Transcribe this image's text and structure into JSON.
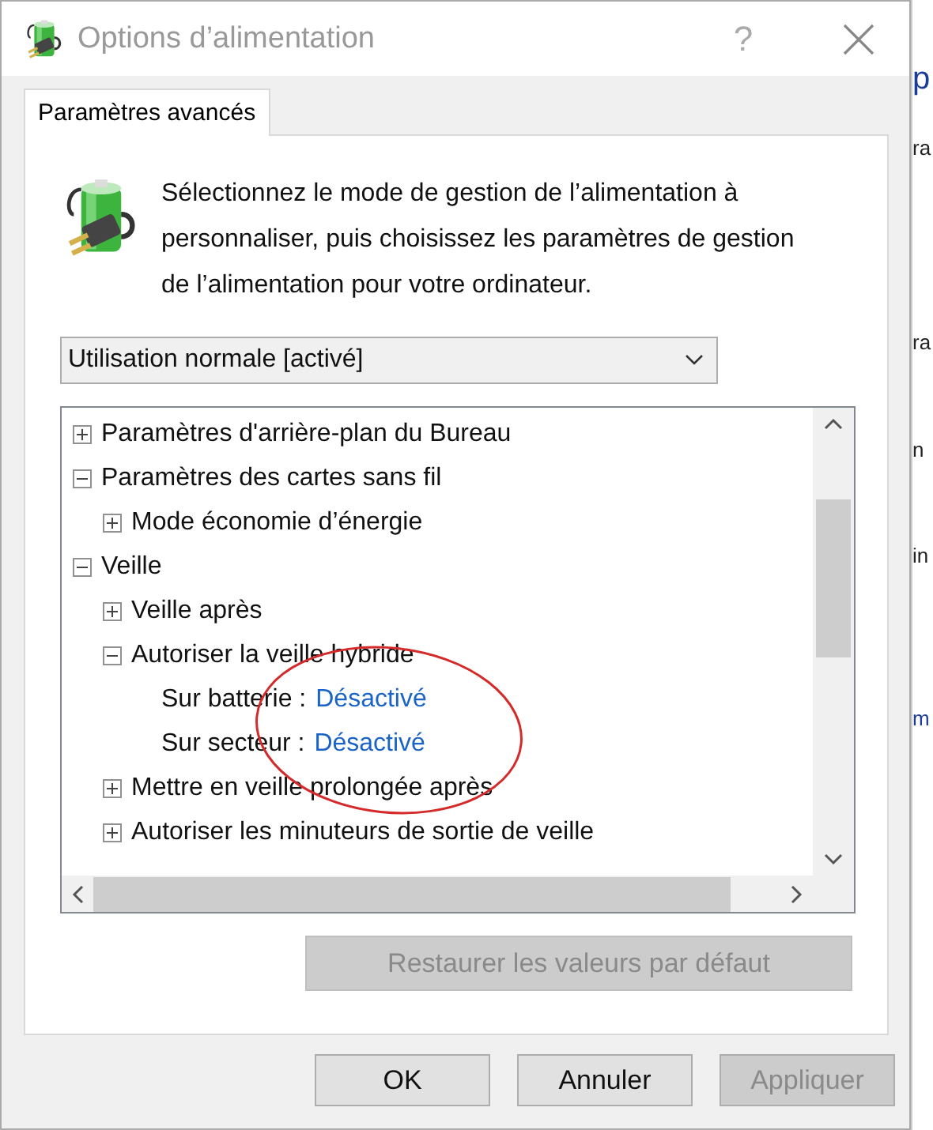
{
  "window": {
    "title": "Options d’alimentation",
    "help": "?"
  },
  "tabs": [
    {
      "label": "Paramètres avancés",
      "selected": true
    }
  ],
  "intro": "Sélectionnez le mode de gestion de l’alimentation à personnaliser, puis choisissez les paramètres de gestion de l’alimentation pour votre ordinateur.",
  "plan_dropdown": {
    "value": "Utilisation normale [activé]"
  },
  "tree": [
    {
      "kind": "group",
      "label": "Paramètres d'arrière-plan du Bureau",
      "expanded": false
    },
    {
      "kind": "group",
      "label": "Paramètres des cartes sans fil",
      "expanded": true,
      "children": [
        {
          "kind": "group",
          "label": "Mode économie d’énergie",
          "expanded": false
        }
      ]
    },
    {
      "kind": "group",
      "label": "Veille",
      "expanded": true,
      "children": [
        {
          "kind": "group",
          "label": "Veille après",
          "expanded": false
        },
        {
          "kind": "group",
          "label": "Autoriser la veille hybride",
          "expanded": true,
          "children": [
            {
              "kind": "setting",
              "label": "Sur batterie :",
              "value": "Désactivé"
            },
            {
              "kind": "setting",
              "label": "Sur secteur :",
              "value": "Désactivé"
            }
          ]
        },
        {
          "kind": "group",
          "label": "Mettre en veille prolongée après",
          "expanded": false
        },
        {
          "kind": "group",
          "label": "Autoriser les minuteurs de sortie de veille",
          "expanded": false
        }
      ]
    }
  ],
  "restore_button": {
    "label": "Restaurer les valeurs par défaut",
    "disabled": true
  },
  "buttons": [
    {
      "label": "OK",
      "disabled": false
    },
    {
      "label": "Annuler",
      "disabled": false
    },
    {
      "label": "Appliquer",
      "disabled": true
    }
  ],
  "background_window": [
    {
      "text": "p",
      "kind": "link"
    },
    {
      "text": "ra",
      "kind": "text"
    },
    {
      "text": "ra",
      "kind": "text"
    },
    {
      "text": "n",
      "kind": "text"
    },
    {
      "text": "in",
      "kind": "text"
    },
    {
      "text": "m",
      "kind": "link"
    }
  ]
}
